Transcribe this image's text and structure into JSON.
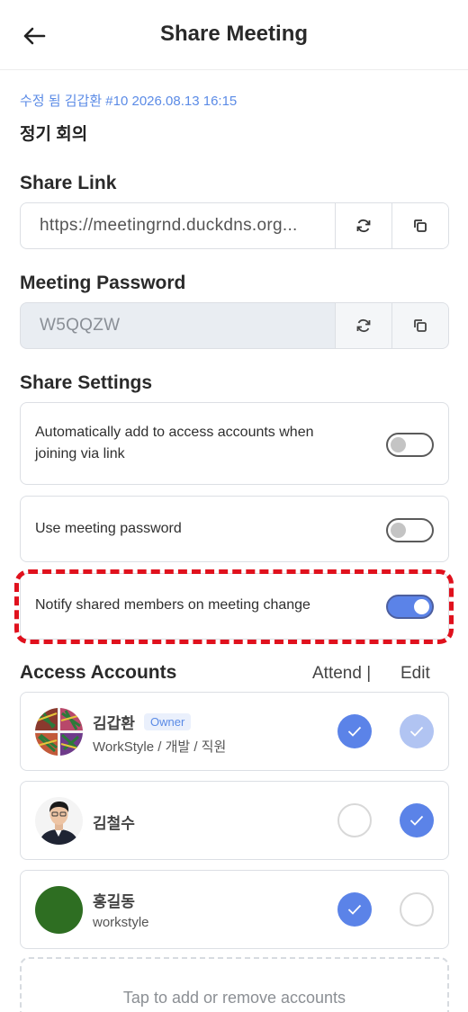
{
  "header": {
    "title": "Share Meeting"
  },
  "meeting": {
    "meta": "수정 됨 김갑환 #10 2026.08.13 16:15",
    "title": "정기 회의"
  },
  "share_link": {
    "label": "Share Link",
    "value": "https://meetingrnd.duckdns.org..."
  },
  "password": {
    "label": "Meeting Password",
    "value": "W5QQZW"
  },
  "share_settings": {
    "label": "Share Settings",
    "items": [
      {
        "text": "Automatically add to access accounts when joining via link",
        "enabled": false
      },
      {
        "text": "Use meeting password",
        "enabled": false
      },
      {
        "text": "Notify shared members on meeting change",
        "enabled": true
      }
    ]
  },
  "access_accounts": {
    "label": "Access Accounts",
    "col_attend": "Attend |",
    "col_edit": "Edit",
    "accounts": [
      {
        "name": "김갑환",
        "badge": "Owner",
        "sub": "WorkStyle / 개발 / 직원",
        "attend": true,
        "edit": true,
        "edit_locked": true
      },
      {
        "name": "김철수",
        "badge": "",
        "sub": "",
        "attend": false,
        "edit": true
      },
      {
        "name": "홍길동",
        "badge": "",
        "sub": "workstyle",
        "attend": true,
        "edit": false
      }
    ],
    "add_prompt": "Tap to add or remove accounts"
  },
  "colors": {
    "accent": "#5b83e8",
    "meta_text": "#5b8be6",
    "highlight": "#e0111d"
  },
  "icons": [
    "back-arrow-icon",
    "refresh-icon",
    "copy-icon",
    "check-icon"
  ]
}
